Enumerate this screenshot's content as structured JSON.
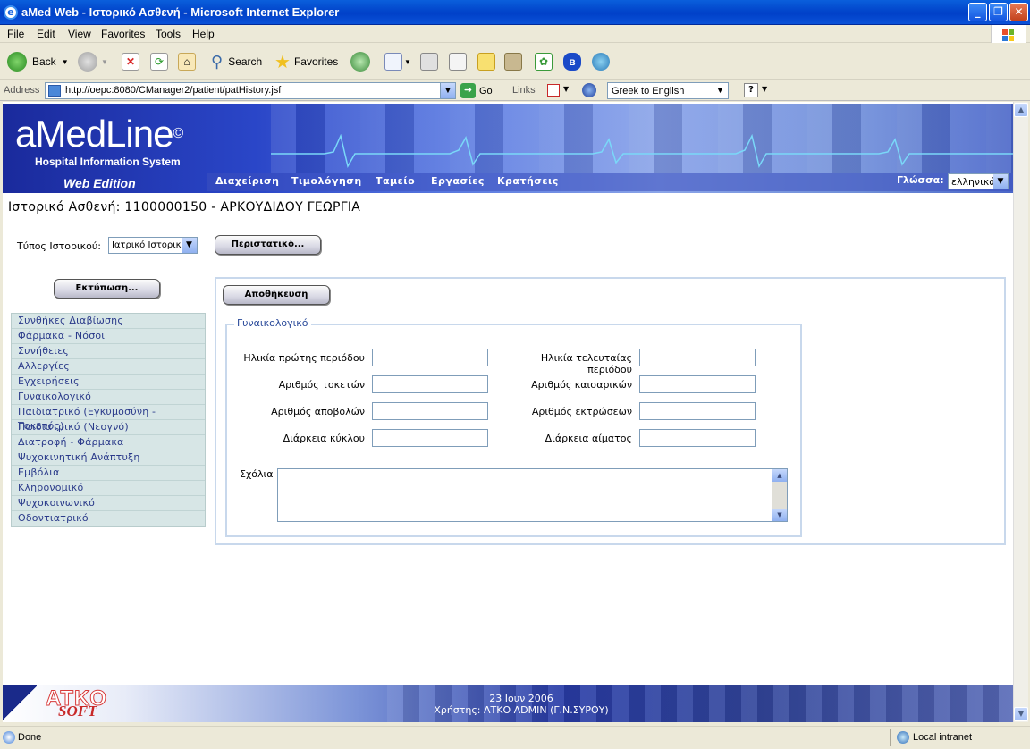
{
  "window": {
    "title": "aMed Web - Ιστορικό Ασθενή - Microsoft Internet Explorer"
  },
  "menubar": [
    "File",
    "Edit",
    "View",
    "Favorites",
    "Tools",
    "Help"
  ],
  "toolbar": {
    "back": "Back",
    "search": "Search",
    "favorites": "Favorites"
  },
  "address": {
    "label": "Address",
    "url": "http://oepc:8080/CManager2/patient/patHistory.jsf",
    "go": "Go",
    "links": "Links",
    "translate": "Greek to English"
  },
  "banner": {
    "logo": "aMedLine",
    "copyright": "©",
    "subtitle": "Hospital Information System",
    "edition": "Web Edition",
    "nav": [
      "Διαχείριση",
      "Τιμολόγηση",
      "Ταμείο",
      "Εργασίες",
      "Κρατήσεις"
    ],
    "language_label": "Γλώσσα:",
    "language_value": "ελληνικά"
  },
  "page": {
    "title": "Ιστορικό Ασθενή: 1100000150 - ΑΡΚΟΥΔΙΔΟΥ ΓΕΩΡΓΙΑ",
    "history_type_label": "Τύπος Ιστορικού:",
    "history_type_value": "Ιατρικό Ιστορικό",
    "incidents_button": "Περιστατικό...",
    "print_button": "Εκτύπωση...",
    "save_button": "Αποθήκευση"
  },
  "sidebar": {
    "items": [
      "Συνθήκες Διαβίωσης",
      "Φάρμακα - Νόσοι",
      "Συνήθειες",
      "Αλλεργίες",
      "Εγχειρήσεις",
      "Γυναικολογικό",
      "Παιδιατρικό (Εγκυμοσύνη - Τοκετός)",
      "Παιδιατρικό (Νεογνό)",
      "Διατροφή - Φάρμακα",
      "Ψυχοκινητική Ανάπτυξη",
      "Εμβόλια",
      "Κληρονομικό",
      "Ψυχοκοινωνικό",
      "Οδοντιατρικό"
    ]
  },
  "form": {
    "legend": "Γυναικολογικό",
    "fields": [
      {
        "left": "Ηλικία πρώτης περιόδου",
        "right": "Ηλικία τελευταίας περιόδου"
      },
      {
        "left": "Αριθμός τοκετών",
        "right": "Αριθμός καισαρικών"
      },
      {
        "left": "Αριθμός αποβολών",
        "right": "Αριθμός εκτρώσεων"
      },
      {
        "left": "Διάρκεια κύκλου",
        "right": "Διάρκεια αίματος"
      }
    ],
    "comments_label": "Σχόλια"
  },
  "footer": {
    "company": "ΑΤΚΟ",
    "soft": "SOFT",
    "date": "23 Ιουν 2006",
    "user": "Χρήστης: ΑΤΚΟ ADMIN (Γ.Ν.ΣΥΡΟΥ)"
  },
  "status": {
    "text": "Done",
    "zone": "Local intranet"
  }
}
